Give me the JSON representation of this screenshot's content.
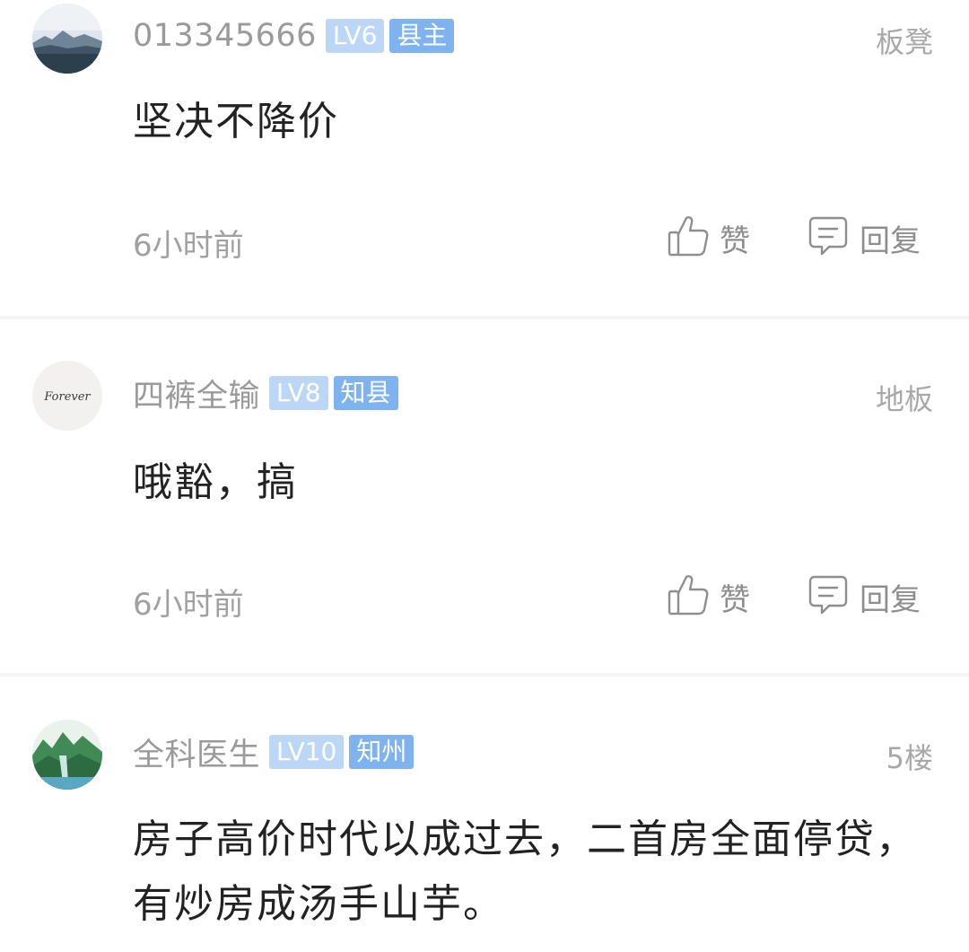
{
  "comments": [
    {
      "username": "013345666",
      "level": "LV6",
      "rank": "县主",
      "floor": "板凳",
      "content": "坚决不降价",
      "time": "6小时前",
      "like_label": "赞",
      "reply_label": "回复"
    },
    {
      "username": "四裤全输",
      "level": "LV8",
      "rank": "知县",
      "floor": "地板",
      "avatar_text": "Forever",
      "content": "哦豁，搞",
      "time": "6小时前",
      "like_label": "赞",
      "reply_label": "回复"
    },
    {
      "username": "全科医生",
      "level": "LV10",
      "rank": "知州",
      "floor": "5楼",
      "content": "房子高价时代以成过去，二首房全面停贷，有炒房成汤手山芋。"
    }
  ],
  "icons": {
    "like": "thumbs-up-icon",
    "reply": "comment-bubble-icon"
  },
  "colors": {
    "level_badge": "#bcd6f6",
    "rank_badge": "#7fb3ef",
    "muted_text": "#9a9a9a",
    "content_text": "#222222",
    "divider": "#f4f4f6"
  }
}
